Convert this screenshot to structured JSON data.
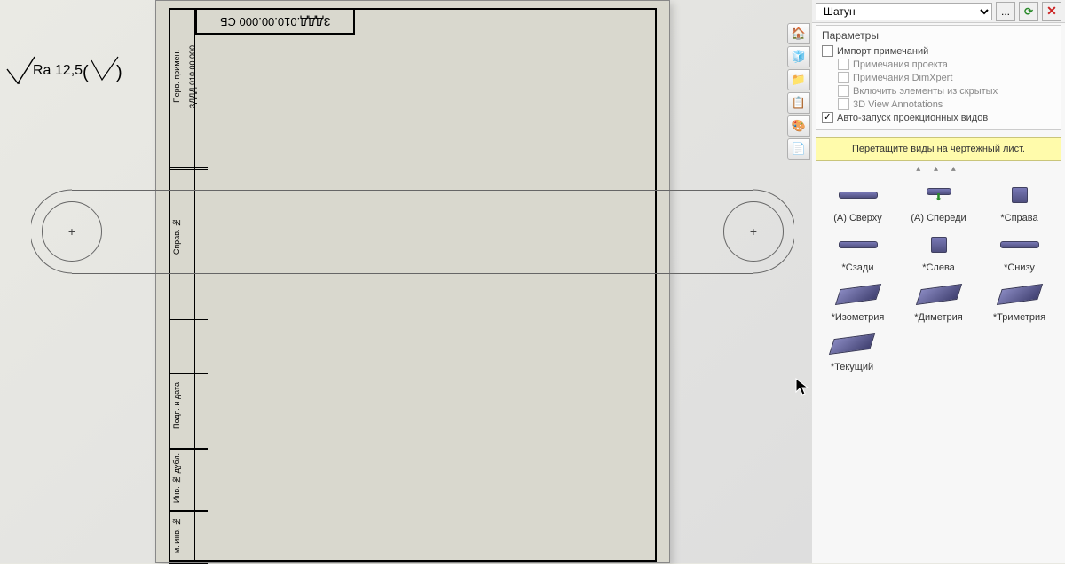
{
  "sheet": {
    "title_block_text": "ЗДДД.010.00.000 СБ",
    "left_labels": {
      "perv_primen": "Перв. примен.",
      "code": "ЗДДД.010.00.000",
      "sprav": "Справ. №",
      "podp_data": "Подп. и дата",
      "inv_dubl": "Инв. № дубл.",
      "inv_n": "м. инв. №"
    }
  },
  "surface": {
    "ra_value": "Ra 12,5"
  },
  "panel": {
    "dropdown_value": "Шатун",
    "ellipsis": "...",
    "params_title": "Параметры",
    "checks": {
      "import_notes": "Импорт примечаний",
      "project_notes": "Примечания проекта",
      "dimxpert_notes": "Примечания DimXpert",
      "hidden_features": "Включить элементы из скрытых",
      "view_annot": "3D View Annotations",
      "autostart": "Авто-запуск проекционных видов"
    },
    "drag_hint": "Перетащите виды на чертежный лист.",
    "views": [
      {
        "label": "(А) Сверху",
        "thumb": "bar"
      },
      {
        "label": "(А) Спереди",
        "thumb": "barshort_arrow"
      },
      {
        "label": "*Справа",
        "thumb": "square"
      },
      {
        "label": "*Сзади",
        "thumb": "bar"
      },
      {
        "label": "*Слева",
        "thumb": "square"
      },
      {
        "label": "*Снизу",
        "thumb": "bar"
      },
      {
        "label": "*Изометрия",
        "thumb": "iso"
      },
      {
        "label": "*Диметрия",
        "thumb": "iso"
      },
      {
        "label": "*Триметрия",
        "thumb": "iso"
      },
      {
        "label": "*Текущий",
        "thumb": "iso"
      }
    ],
    "tab_icons": [
      "🏠",
      "🧊",
      "📁",
      "📋",
      "🎨",
      "📄"
    ]
  }
}
